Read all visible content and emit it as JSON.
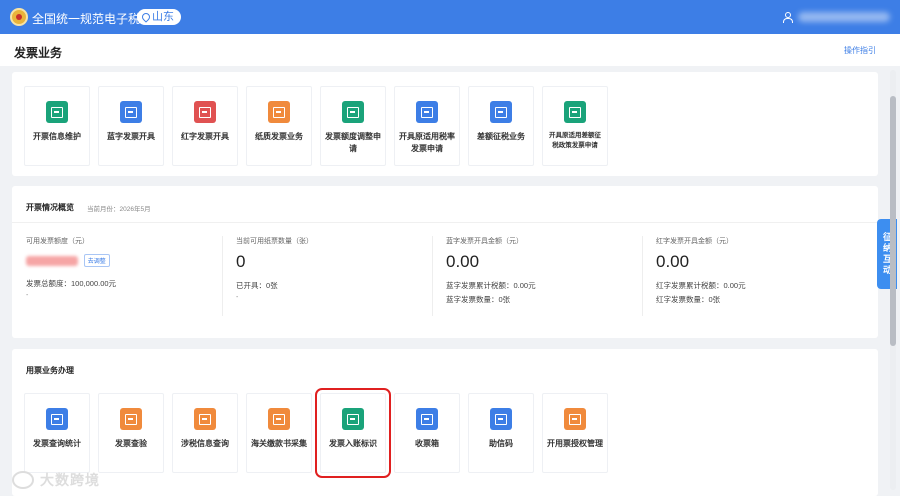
{
  "topbar": {
    "site_title": "全国统一规范电子税务局",
    "region": "山东"
  },
  "header": {
    "page_title": "发票业务",
    "guide_link": "操作指引"
  },
  "invoice_ops": {
    "tiles": [
      {
        "label": "开票信息维护",
        "color": "#1aa37a",
        "icon": "edit-icon"
      },
      {
        "label": "蓝字发票开具",
        "color": "#3d7ee6",
        "icon": "invoice-icon"
      },
      {
        "label": "红字发票开具",
        "color": "#e05252",
        "icon": "invoice-icon"
      },
      {
        "label": "纸质发票业务",
        "color": "#f08a3c",
        "icon": "paper-icon"
      },
      {
        "label": "发票额度调整申请",
        "color": "#1aa37a",
        "icon": "edit-icon"
      },
      {
        "label": "开具原适用税率发票申请",
        "color": "#3d7ee6",
        "icon": "doc-icon"
      },
      {
        "label": "差额征税业务",
        "color": "#3d7ee6",
        "icon": "doc-icon"
      },
      {
        "label": "开具原适用差额征税政策发票申请",
        "color": "#1aa37a",
        "icon": "doc-icon"
      }
    ]
  },
  "overview": {
    "title": "开票情况概览",
    "month_label": "当前月份：2026年5月",
    "col1": {
      "label": "可用发票额度（元）",
      "adjust": "去调整",
      "total": "发票总额度：100,000.00元",
      "dash": "-"
    },
    "col2": {
      "label": "当前可用纸票数量（张）",
      "value": "0",
      "issued": "已开具：0张",
      "dash": "-"
    },
    "col3": {
      "label": "蓝字发票开具金额（元）",
      "value": "0.00",
      "tax": "蓝字发票累计税额：0.00元",
      "count": "蓝字发票数量：0张"
    },
    "col4": {
      "label": "红字发票开具金额（元）",
      "value": "0.00",
      "tax": "红字发票累计税额：0.00元",
      "count": "红字发票数量：0张"
    }
  },
  "usage": {
    "title": "用票业务办理",
    "tiles": [
      {
        "label": "发票查询统计",
        "color": "#3d7ee6",
        "icon": "search-icon"
      },
      {
        "label": "发票查验",
        "color": "#f08a3c",
        "icon": "verify-icon"
      },
      {
        "label": "涉税信息查询",
        "color": "#f08a3c",
        "icon": "search-icon"
      },
      {
        "label": "海关缴款书采集",
        "color": "#f08a3c",
        "icon": "customs-icon"
      },
      {
        "label": "发票入账标识",
        "color": "#1aa37a",
        "icon": "ledger-icon"
      },
      {
        "label": "收票箱",
        "color": "#3d7ee6",
        "icon": "mail-icon"
      },
      {
        "label": "助信码",
        "color": "#3d7ee6",
        "icon": "qrcode-icon"
      },
      {
        "label": "开用票授权管理",
        "color": "#f08a3c",
        "icon": "auth-icon"
      }
    ]
  },
  "side_tab": {
    "label": "征纳互动"
  },
  "watermark": {
    "text": "大数跨境"
  }
}
